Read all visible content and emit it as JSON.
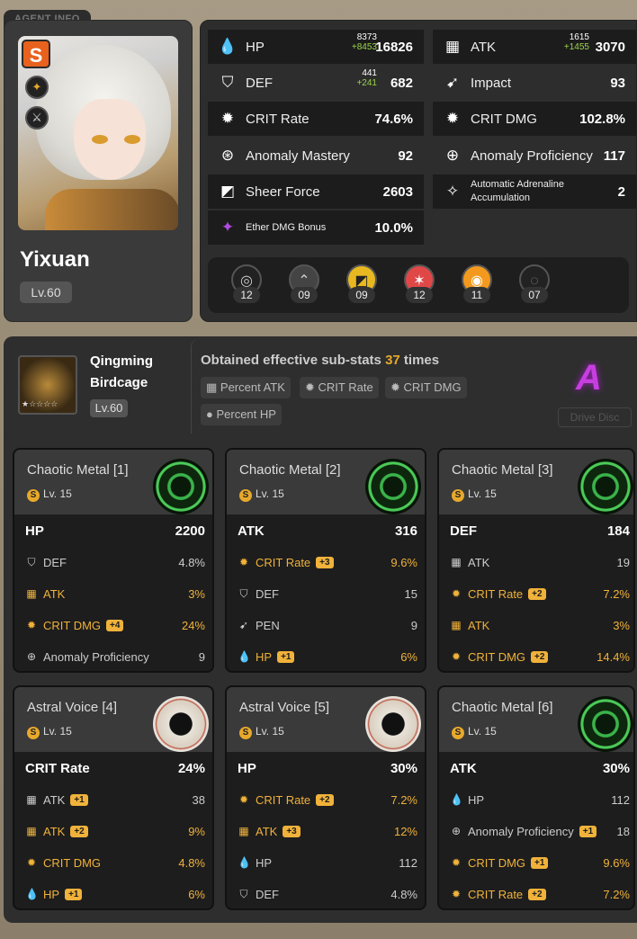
{
  "agent": {
    "section_title": "AGENT INFO",
    "name": "Yixuan",
    "level": "Lv.60",
    "rank": "S"
  },
  "stats": [
    {
      "icon": "hp-icon",
      "label": "HP",
      "value": "16826",
      "base": "8373",
      "bonus": "+8453"
    },
    {
      "icon": "atk-icon",
      "label": "ATK",
      "value": "3070",
      "base": "1615",
      "bonus": "+1455"
    },
    {
      "icon": "def-icon",
      "label": "DEF",
      "value": "682",
      "base": "441",
      "bonus": "+241"
    },
    {
      "icon": "impact-icon",
      "label": "Impact",
      "value": "93"
    },
    {
      "icon": "crit-rate-icon",
      "label": "CRIT Rate",
      "value": "74.6%"
    },
    {
      "icon": "crit-dmg-icon",
      "label": "CRIT DMG",
      "value": "102.8%"
    },
    {
      "icon": "anomaly-mastery-icon",
      "label": "Anomaly Mastery",
      "value": "92"
    },
    {
      "icon": "anomaly-proficiency-icon",
      "label": "Anomaly Proficiency",
      "value": "117"
    },
    {
      "icon": "sheer-force-icon",
      "label": "Sheer Force",
      "value": "2603"
    },
    {
      "icon": "adrenaline-icon",
      "label": "Automatic Adrenaline Accumulation",
      "value": "2"
    },
    {
      "icon": "ether-dmg-icon",
      "label": "Ether DMG Bonus",
      "value": "10.0%"
    }
  ],
  "skills": [
    "12",
    "09",
    "09",
    "12",
    "11",
    "07"
  ],
  "wengine": {
    "name_line1": "Qingming",
    "name_line2": "Birdcage",
    "level": "Lv.60",
    "stars": "★☆☆☆☆"
  },
  "substats_summary": {
    "prefix": "Obtained effective sub-stats",
    "count": "37",
    "suffix": "times",
    "tags": [
      "Percent ATK",
      "CRIT Rate",
      "CRIT DMG",
      "Percent HP"
    ]
  },
  "grade": "A",
  "drive_disc_button": "Drive Disc",
  "discs": [
    {
      "name": "Chaotic Metal [1]",
      "level": "Lv. 15",
      "set": "chaotic",
      "main": {
        "label": "HP",
        "value": "2200"
      },
      "subs": [
        {
          "icon": "def-icon",
          "label": "DEF",
          "value": "4.8%",
          "hl": false,
          "roll": ""
        },
        {
          "icon": "atk-icon",
          "label": "ATK",
          "value": "3%",
          "hl": true,
          "roll": ""
        },
        {
          "icon": "crit-dmg-icon",
          "label": "CRIT DMG",
          "value": "24%",
          "hl": true,
          "roll": "+4"
        },
        {
          "icon": "anomaly-proficiency-icon",
          "label": "Anomaly Proficiency",
          "value": "9",
          "hl": false,
          "roll": ""
        }
      ]
    },
    {
      "name": "Chaotic Metal [2]",
      "level": "Lv. 15",
      "set": "chaotic",
      "main": {
        "label": "ATK",
        "value": "316"
      },
      "subs": [
        {
          "icon": "crit-rate-icon",
          "label": "CRIT Rate",
          "value": "9.6%",
          "hl": true,
          "roll": "+3"
        },
        {
          "icon": "def-icon",
          "label": "DEF",
          "value": "15",
          "hl": false,
          "roll": ""
        },
        {
          "icon": "pen-icon",
          "label": "PEN",
          "value": "9",
          "hl": false,
          "roll": ""
        },
        {
          "icon": "hp-icon",
          "label": "HP",
          "value": "6%",
          "hl": true,
          "roll": "+1"
        }
      ]
    },
    {
      "name": "Chaotic Metal [3]",
      "level": "Lv. 15",
      "set": "chaotic",
      "main": {
        "label": "DEF",
        "value": "184"
      },
      "subs": [
        {
          "icon": "atk-icon",
          "label": "ATK",
          "value": "19",
          "hl": false,
          "roll": ""
        },
        {
          "icon": "crit-rate-icon",
          "label": "CRIT Rate",
          "value": "7.2%",
          "hl": true,
          "roll": "+2"
        },
        {
          "icon": "atk-icon",
          "label": "ATK",
          "value": "3%",
          "hl": true,
          "roll": ""
        },
        {
          "icon": "crit-dmg-icon",
          "label": "CRIT DMG",
          "value": "14.4%",
          "hl": true,
          "roll": "+2"
        }
      ]
    },
    {
      "name": "Astral Voice [4]",
      "level": "Lv. 15",
      "set": "astral",
      "main": {
        "label": "CRIT Rate",
        "value": "24%"
      },
      "subs": [
        {
          "icon": "atk-icon",
          "label": "ATK",
          "value": "38",
          "hl": false,
          "roll": "+1"
        },
        {
          "icon": "atk-icon",
          "label": "ATK",
          "value": "9%",
          "hl": true,
          "roll": "+2"
        },
        {
          "icon": "crit-dmg-icon",
          "label": "CRIT DMG",
          "value": "4.8%",
          "hl": true,
          "roll": ""
        },
        {
          "icon": "hp-icon",
          "label": "HP",
          "value": "6%",
          "hl": true,
          "roll": "+1"
        }
      ]
    },
    {
      "name": "Astral Voice [5]",
      "level": "Lv. 15",
      "set": "astral",
      "main": {
        "label": "HP",
        "value": "30%"
      },
      "subs": [
        {
          "icon": "crit-rate-icon",
          "label": "CRIT Rate",
          "value": "7.2%",
          "hl": true,
          "roll": "+2"
        },
        {
          "icon": "atk-icon",
          "label": "ATK",
          "value": "12%",
          "hl": true,
          "roll": "+3"
        },
        {
          "icon": "hp-icon",
          "label": "HP",
          "value": "112",
          "hl": false,
          "roll": ""
        },
        {
          "icon": "def-icon",
          "label": "DEF",
          "value": "4.8%",
          "hl": false,
          "roll": ""
        }
      ]
    },
    {
      "name": "Chaotic Metal [6]",
      "level": "Lv. 15",
      "set": "chaotic",
      "main": {
        "label": "ATK",
        "value": "30%"
      },
      "subs": [
        {
          "icon": "hp-icon",
          "label": "HP",
          "value": "112",
          "hl": false,
          "roll": ""
        },
        {
          "icon": "anomaly-proficiency-icon",
          "label": "Anomaly Proficiency",
          "value": "18",
          "hl": false,
          "roll": "+1"
        },
        {
          "icon": "crit-dmg-icon",
          "label": "CRIT DMG",
          "value": "9.6%",
          "hl": true,
          "roll": "+1"
        },
        {
          "icon": "crit-rate-icon",
          "label": "CRIT Rate",
          "value": "7.2%",
          "hl": true,
          "roll": "+2"
        }
      ]
    }
  ]
}
